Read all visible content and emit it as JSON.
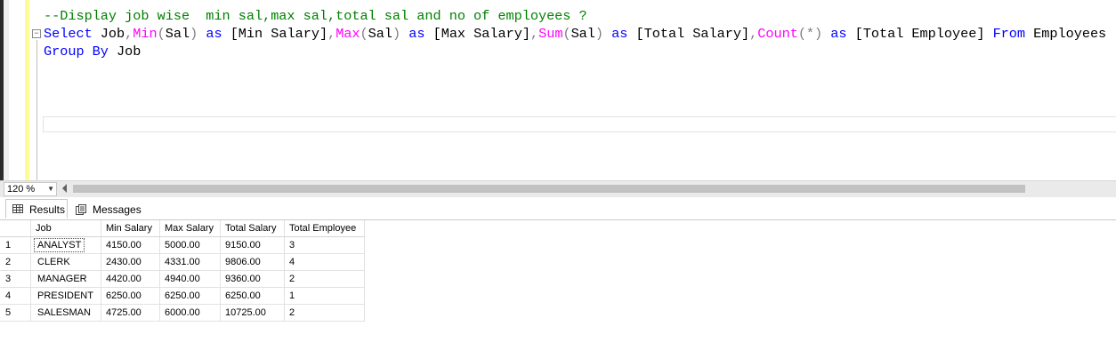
{
  "editor": {
    "lines": [
      [
        {
          "t": "--Display job wise  min sal,max sal,total sal and no of employees ?",
          "c": "cm"
        }
      ],
      [
        {
          "t": "Select",
          "c": "kw"
        },
        {
          "t": " Job",
          "c": "tx"
        },
        {
          "t": ",",
          "c": "op"
        },
        {
          "t": "Min",
          "c": "fn"
        },
        {
          "t": "(",
          "c": "op"
        },
        {
          "t": "Sal",
          "c": "tx"
        },
        {
          "t": ")",
          "c": "op"
        },
        {
          "t": " as ",
          "c": "kw"
        },
        {
          "t": "[Min Salary]",
          "c": "tx"
        },
        {
          "t": ",",
          "c": "op"
        },
        {
          "t": "Max",
          "c": "fn"
        },
        {
          "t": "(",
          "c": "op"
        },
        {
          "t": "Sal",
          "c": "tx"
        },
        {
          "t": ")",
          "c": "op"
        },
        {
          "t": " as ",
          "c": "kw"
        },
        {
          "t": "[Max Salary]",
          "c": "tx"
        },
        {
          "t": ",",
          "c": "op"
        },
        {
          "t": "Sum",
          "c": "fn"
        },
        {
          "t": "(",
          "c": "op"
        },
        {
          "t": "Sal",
          "c": "tx"
        },
        {
          "t": ")",
          "c": "op"
        },
        {
          "t": " as ",
          "c": "kw"
        },
        {
          "t": "[Total Salary]",
          "c": "tx"
        },
        {
          "t": ",",
          "c": "op"
        },
        {
          "t": "Count",
          "c": "fn"
        },
        {
          "t": "(*)",
          "c": "op"
        },
        {
          "t": " as ",
          "c": "kw"
        },
        {
          "t": "[Total Employee]",
          "c": "tx"
        },
        {
          "t": " From ",
          "c": "kw"
        },
        {
          "t": "Employees",
          "c": "tx"
        }
      ],
      [
        {
          "t": "Group By",
          "c": "kw"
        },
        {
          "t": " Job",
          "c": "tx"
        }
      ]
    ],
    "fold_glyph": "−"
  },
  "zoom": {
    "value": "120 %",
    "arrow": "▼"
  },
  "tabs": {
    "results": "Results",
    "messages": "Messages"
  },
  "grid": {
    "columns": [
      "",
      "Job",
      "Min Salary",
      "Max Salary",
      "Total Salary",
      "Total Employee"
    ],
    "rows": [
      [
        "1",
        "ANALYST",
        "4150.00",
        "5000.00",
        "9150.00",
        "3"
      ],
      [
        "2",
        "CLERK",
        "2430.00",
        "4331.00",
        "9806.00",
        "4"
      ],
      [
        "3",
        "MANAGER",
        "4420.00",
        "4940.00",
        "9360.00",
        "2"
      ],
      [
        "4",
        "PRESIDENT",
        "6250.00",
        "6250.00",
        "6250.00",
        "1"
      ],
      [
        "5",
        "SALESMAN",
        "4725.00",
        "6000.00",
        "10725.00",
        "2"
      ]
    ]
  },
  "colors": {
    "comment": "#008000",
    "keyword": "#0000ff",
    "function": "#ff00ff",
    "operator": "#808080"
  }
}
